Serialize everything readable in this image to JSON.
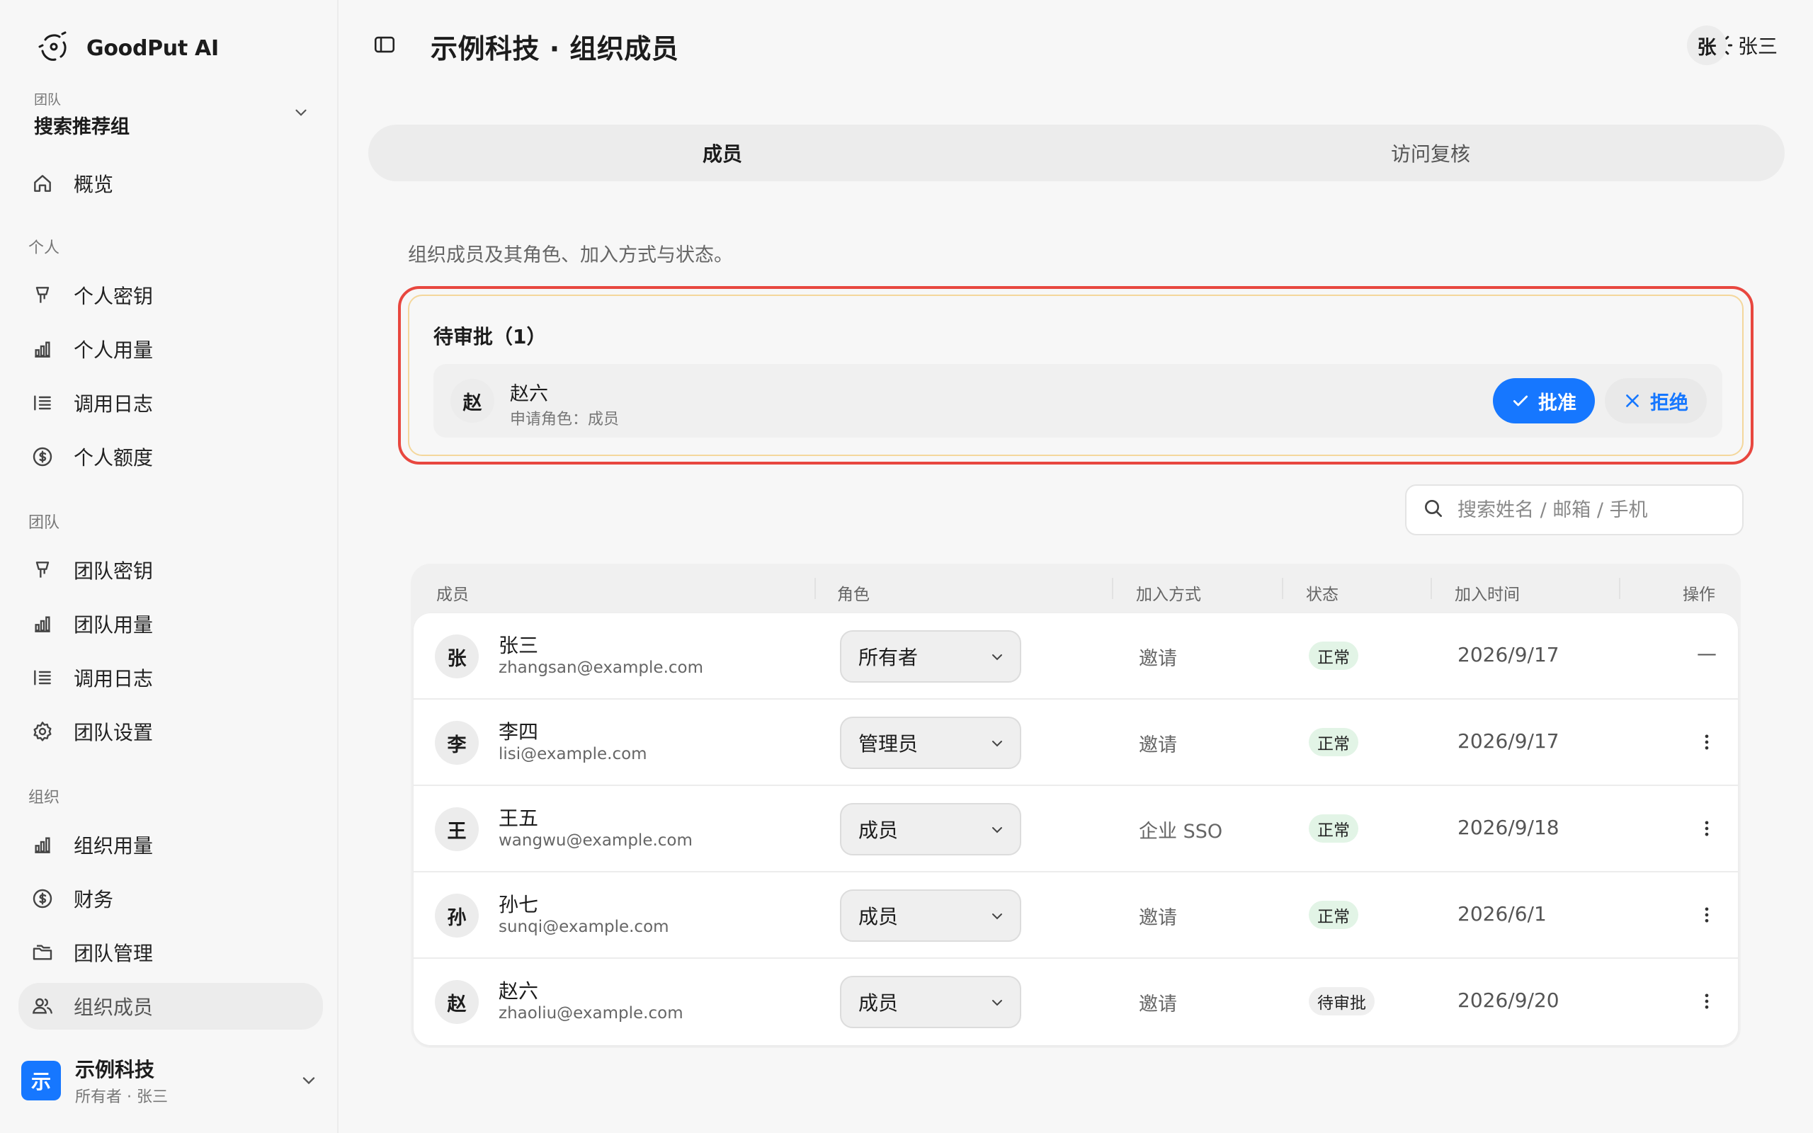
{
  "app": {
    "name": "GoodPut AI"
  },
  "team": {
    "caption": "团队",
    "name": "搜索推荐组"
  },
  "nav": {
    "overview": "概览",
    "personal_section": "个人",
    "personal": [
      "个人密钥",
      "个人用量",
      "调用日志",
      "个人额度"
    ],
    "team_section": "团队",
    "team": [
      "团队密钥",
      "团队用量",
      "调用日志",
      "团队设置"
    ],
    "org_section": "组织",
    "org": [
      "组织用量",
      "财务",
      "团队管理",
      "组织成员"
    ],
    "active": "组织成员"
  },
  "org": {
    "logo": "示",
    "name": "示例科技",
    "sub": "所有者 · 张三"
  },
  "header": {
    "title": "示例科技 · 组织成员",
    "user_avatar": "张",
    "user_name": "张三"
  },
  "tabs": [
    {
      "label": "成员",
      "active": true
    },
    {
      "label": "访问复核",
      "active": false
    }
  ],
  "intro": "组织成员及其角色、加入方式与状态。",
  "pending": {
    "title": "待审批（1）",
    "item": {
      "avatar": "赵",
      "name": "赵六",
      "role": "申请角色：成员"
    },
    "approve": "批准",
    "reject": "拒绝"
  },
  "search": {
    "placeholder": "搜索姓名 / 邮箱 / 手机"
  },
  "table": {
    "headers": [
      "成员",
      "角色",
      "加入方式",
      "状态",
      "加入时间",
      "操作"
    ],
    "rows": [
      {
        "avatar": "张",
        "name": "张三",
        "email": "zhangsan@example.com",
        "role": "所有者",
        "join": "邀请",
        "status": "正常",
        "date": "2026/9/17",
        "action": "—"
      },
      {
        "avatar": "李",
        "name": "李四",
        "email": "lisi@example.com",
        "role": "管理员",
        "join": "邀请",
        "status": "正常",
        "date": "2026/9/17",
        "action": ""
      },
      {
        "avatar": "王",
        "name": "王五",
        "email": "wangwu@example.com",
        "role": "成员",
        "join": "企业 SSO",
        "status": "正常",
        "date": "2026/9/18",
        "action": ""
      },
      {
        "avatar": "孙",
        "name": "孙七",
        "email": "sunqi@example.com",
        "role": "成员",
        "join": "邀请",
        "status": "正常",
        "date": "2026/6/1",
        "action": ""
      },
      {
        "avatar": "赵",
        "name": "赵六",
        "email": "zhaoliu@example.com",
        "role": "成员",
        "join": "邀请",
        "status": "待审批",
        "date": "2026/9/20",
        "action": ""
      }
    ]
  },
  "colors": {
    "accent": "#1677ff",
    "highlight": "#e8473f",
    "pending_border": "#f4d79c",
    "status_ok": "#e2f4e6"
  }
}
